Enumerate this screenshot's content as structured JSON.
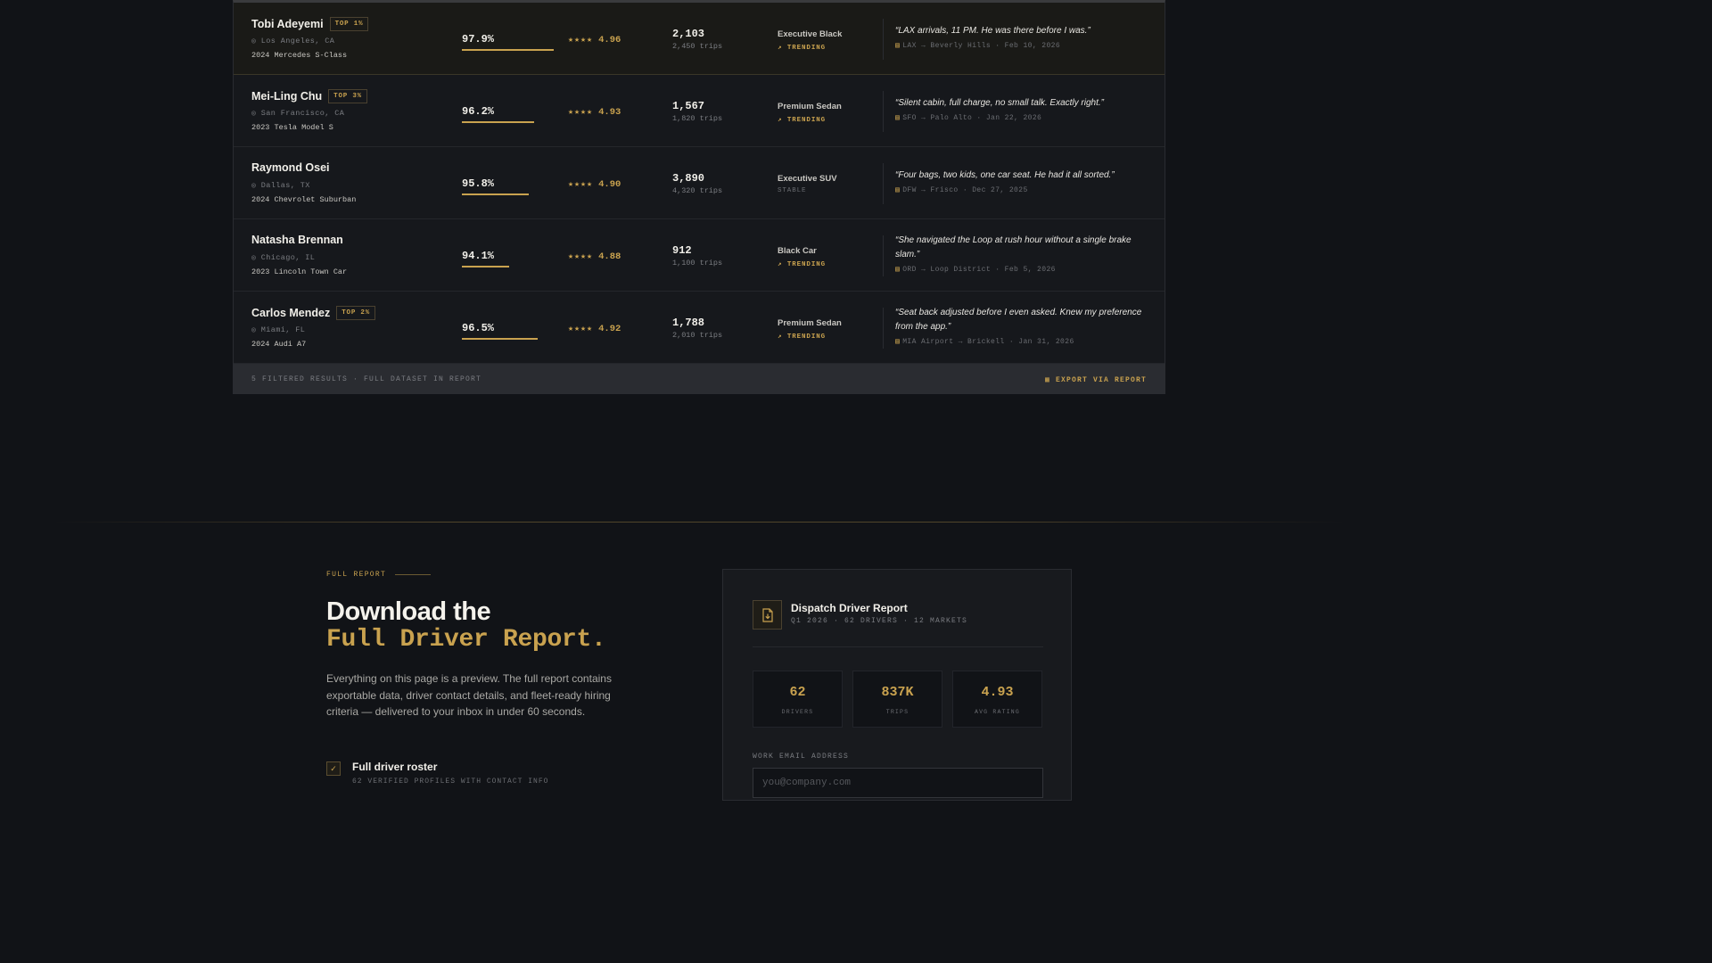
{
  "drivers": [
    {
      "name": "Tobi Adeyemi",
      "badge": "TOP 1%",
      "city": "Los Angeles, CA",
      "car": "2024 Mercedes S-Class",
      "pct": "97.9%",
      "pct_value": 97.9,
      "stars": "★★★★",
      "rating": "4.96",
      "trips": "2,103",
      "trips_sub": "2,450 trips",
      "tier": "Executive Black",
      "trend": "TRENDING",
      "trend_icon": "↗",
      "quote": "“LAX arrivals, 11 PM. He was there before I was.”",
      "route": "LAX → Beverly Hills · Feb 10, 2026"
    },
    {
      "name": "Mei-Ling Chu",
      "badge": "TOP 3%",
      "city": "San Francisco, CA",
      "car": "2023 Tesla Model S",
      "pct": "96.2%",
      "pct_value": 96.2,
      "stars": "★★★★",
      "rating": "4.93",
      "trips": "1,567",
      "trips_sub": "1,820 trips",
      "tier": "Premium Sedan",
      "trend": "TRENDING",
      "trend_icon": "↗",
      "quote": "“Silent cabin, full charge, no small talk. Exactly right.”",
      "route": "SFO → Palo Alto · Jan 22, 2026"
    },
    {
      "name": "Raymond Osei",
      "badge": "",
      "city": "Dallas, TX",
      "car": "2024 Chevrolet Suburban",
      "pct": "95.8%",
      "pct_value": 95.8,
      "stars": "★★★★",
      "rating": "4.90",
      "trips": "3,890",
      "trips_sub": "4,320 trips",
      "tier": "Executive SUV",
      "trend": "STABLE",
      "trend_icon": "",
      "quote": "“Four bags, two kids, one car seat. He had it all sorted.”",
      "route": "DFW → Frisco · Dec 27, 2025"
    },
    {
      "name": "Natasha Brennan",
      "badge": "",
      "city": "Chicago, IL",
      "car": "2023 Lincoln Town Car",
      "pct": "94.1%",
      "pct_value": 94.1,
      "stars": "★★★★",
      "rating": "4.88",
      "trips": "912",
      "trips_sub": "1,100 trips",
      "tier": "Black Car",
      "trend": "TRENDING",
      "trend_icon": "↗",
      "quote": "“She navigated the Loop at rush hour without a single brake slam.”",
      "route": "ORD → Loop District · Feb 5, 2026"
    },
    {
      "name": "Carlos Mendez",
      "badge": "TOP 2%",
      "city": "Miami, FL",
      "car": "2024 Audi A7",
      "pct": "96.5%",
      "pct_value": 96.5,
      "stars": "★★★★",
      "rating": "4.92",
      "trips": "1,788",
      "trips_sub": "2,010 trips",
      "tier": "Premium Sedan",
      "trend": "TRENDING",
      "trend_icon": "↗",
      "quote": "“Seat back adjusted before I even asked. Knew my preference from the app.”",
      "route": "MIA Airport → Brickell · Jan 31, 2026"
    }
  ],
  "table_footer": {
    "left": "5 FILTERED RESULTS · FULL DATASET IN REPORT",
    "export_label": "EXPORT VIA REPORT",
    "export_icon": "▦"
  },
  "report": {
    "eyebrow": "FULL REPORT",
    "heading_line1": "Download the",
    "heading_line2": "Full Driver Report.",
    "lead": "Everything on this page is a preview. The full report contains exportable data, driver contact details, and fleet-ready hiring criteria — delivered to your inbox in under 60 seconds.",
    "checklist": [
      {
        "title": "Full driver roster",
        "sub": "62 VERIFIED PROFILES WITH CONTACT INFO",
        "icon": "✓"
      }
    ],
    "card": {
      "title": "Dispatch Driver Report",
      "sub": "Q1 2026 · 62 DRIVERS · 12 MARKETS",
      "stats": [
        {
          "value": "62",
          "label": "DRIVERS"
        },
        {
          "value": "837K",
          "label": "TRIPS"
        },
        {
          "value": "4.93",
          "label": "AVG RATING"
        }
      ],
      "email_label": "WORK EMAIL ADDRESS",
      "email_placeholder": "you@company.com",
      "email_value": ""
    }
  },
  "colors": {
    "accent": "#c9a24f",
    "bg": "#111317",
    "panel": "#16181c"
  }
}
